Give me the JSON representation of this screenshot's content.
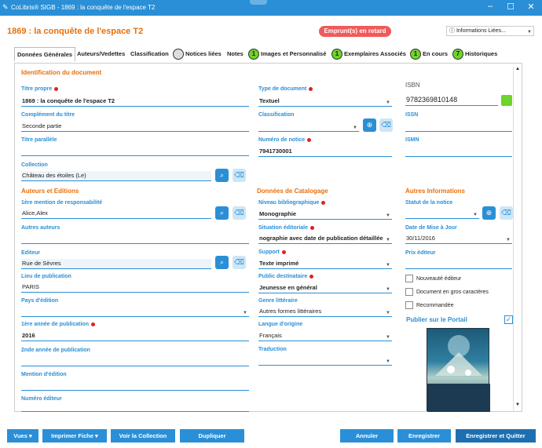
{
  "window": {
    "title": "CoLibris® SIGB - 1869 : la conquête de l'espace T2"
  },
  "header": {
    "doc_title": "1869 : la conquête de l'espace T2",
    "late_badge": "Emprunt(s) en retard",
    "related_info": "Informations Liées..."
  },
  "tabs": [
    {
      "label": "Données Générales"
    },
    {
      "label": "Auteurs/Vedettes"
    },
    {
      "label": "Classification"
    },
    {
      "label": "Notices liées",
      "count": ""
    },
    {
      "label": "Notes"
    },
    {
      "label": "Images et Personnalisé",
      "count": "1"
    },
    {
      "label": "Exemplaires Associés",
      "count": "1"
    },
    {
      "label": "En cours",
      "count": "1"
    },
    {
      "label": "Historiques",
      "count": "7"
    }
  ],
  "identification": {
    "section": "Identification du document",
    "titre_propre": {
      "label": "Titre propre",
      "value": "1869 : la conquête de l'espace T2"
    },
    "complement": {
      "label": "Complément du titre",
      "value": "Seconde partie"
    },
    "titre_parallele": {
      "label": "Titre parallèle",
      "value": ""
    },
    "collection": {
      "label": "Collection",
      "value": "Château des étoiles (Le)"
    },
    "type_doc": {
      "label": "Type de document",
      "value": "Textuel"
    },
    "classification": {
      "label": "Classification",
      "value": ""
    },
    "num_notice": {
      "label": "Numéro de notice",
      "value": "7941730001"
    },
    "isbn": {
      "label": "ISBN",
      "value": "9782369810148"
    },
    "issn": {
      "label": "ISSN",
      "value": ""
    },
    "ismn": {
      "label": "ISMN",
      "value": ""
    }
  },
  "auteurs": {
    "section": "Auteurs et Editions",
    "mention_resp": {
      "label": "1ère mention de responsabilité",
      "value": "Alice,Alex"
    },
    "autres_auteurs": {
      "label": "Autres auteurs",
      "value": ""
    },
    "editeur": {
      "label": "Editeur",
      "value": "Rue de Sèvres"
    },
    "lieu_pub": {
      "label": "Lieu de publication",
      "value": "PARIS"
    },
    "pays": {
      "label": "Pays d'édition",
      "value": ""
    },
    "annee1": {
      "label": "1ère année de publication",
      "value": "2016"
    },
    "annee2": {
      "label": "2nde année de publication",
      "value": ""
    },
    "mention_ed": {
      "label": "Mention d'édition",
      "value": ""
    },
    "num_editeur": {
      "label": "Numéro éditeur",
      "value": ""
    }
  },
  "catalogage": {
    "section": "Données de Catalogage",
    "niveau": {
      "label": "Niveau bibliographique",
      "value": "Monographie"
    },
    "situation": {
      "label": "Situation éditoriale",
      "value": "nographie avec date de publication détaillée"
    },
    "support": {
      "label": "Support",
      "value": "Texte imprimé"
    },
    "public": {
      "label": "Public destinataire",
      "value": "Jeunesse en général"
    },
    "genre": {
      "label": "Genre littéraire",
      "value": "Autres formes littéraires"
    },
    "langue": {
      "label": "Langue d'origine",
      "value": "Français"
    },
    "traduction": {
      "label": "Traduction",
      "value": ""
    }
  },
  "autres": {
    "section": "Autres Informations",
    "statut": {
      "label": "Statut de la notice",
      "value": ""
    },
    "date_maj": {
      "label": "Date de Mise à Jour",
      "value": "30/11/2016"
    },
    "prix": {
      "label": "Prix éditeur",
      "value": ""
    },
    "nouveaute": "Nouveauté éditeur",
    "gros_car": "Document en gros caractères",
    "recommande": "Recommandée",
    "publier": "Publier sur le Portail"
  },
  "footer": {
    "vues": "Vues",
    "imprimer": "Imprimer Fiche",
    "voir_collection": "Voir la Collection",
    "dupliquer": "Dupliquer",
    "annuler": "Annuler",
    "enregistrer": "Enregistrer",
    "enregistrer_quitter": "Enregistrer et Quitter"
  },
  "colors": {
    "accent": "#2a8fd6",
    "section": "#e8700a",
    "badge": "#f05a5a",
    "count_badge": "#6ed32a"
  }
}
